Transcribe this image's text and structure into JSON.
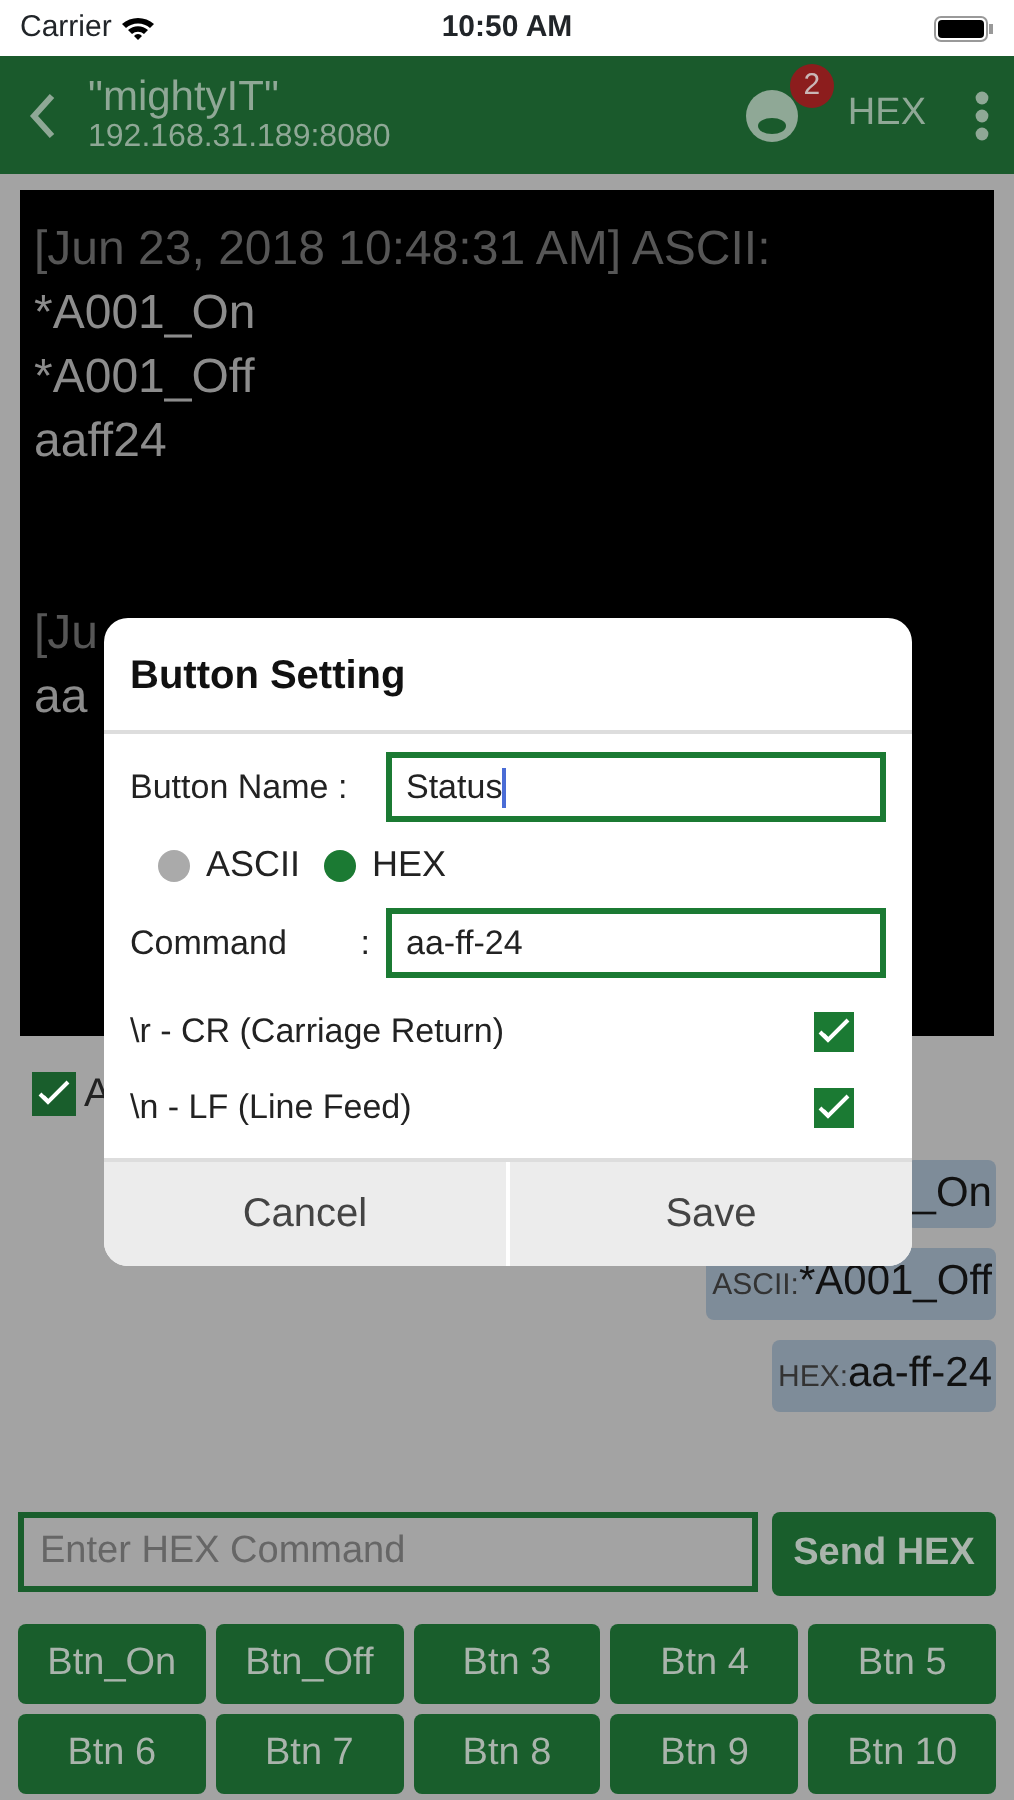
{
  "status_bar": {
    "carrier": "Carrier",
    "time": "10:50 AM"
  },
  "header": {
    "title": "\"mightyIT\"",
    "subtitle": "192.168.31.189:8080",
    "badge": "2",
    "mode": "HEX"
  },
  "log": [
    {
      "header": "[Jun 23, 2018 10:48:31 AM] ASCII:",
      "lines": [
        "*A001_On",
        "*A001_Off",
        "aaff24"
      ]
    },
    {
      "header": "[Ju",
      "lines": [
        "aa"
      ]
    }
  ],
  "option": {
    "label": "A",
    "checked": true
  },
  "messages": [
    {
      "text": "_On"
    },
    {
      "prefix": "ASCII:",
      "text": "*A001_Off"
    },
    {
      "prefix": "HEX:",
      "text": "aa-ff-24"
    }
  ],
  "command_input": {
    "placeholder": "Enter HEX Command"
  },
  "send_button": "Send HEX",
  "quick_buttons": [
    "Btn_On",
    "Btn_Off",
    "Btn 3",
    "Btn 4",
    "Btn 5",
    "Btn 6",
    "Btn 7",
    "Btn 8",
    "Btn 9",
    "Btn 10"
  ],
  "dialog": {
    "title": "Button Setting",
    "name_label": "Button Name :",
    "name_value": "Status",
    "formats": [
      {
        "label": "ASCII",
        "selected": false
      },
      {
        "label": "HEX",
        "selected": true
      }
    ],
    "command_label": "Command",
    "command_colon": ":",
    "command_value": "aa-ff-24",
    "options": [
      {
        "label": "\\r - CR (Carriage Return)",
        "checked": true
      },
      {
        "label": "\\n - LF (Line Feed)",
        "checked": true
      }
    ],
    "buttons": [
      "Cancel",
      "Save"
    ]
  }
}
